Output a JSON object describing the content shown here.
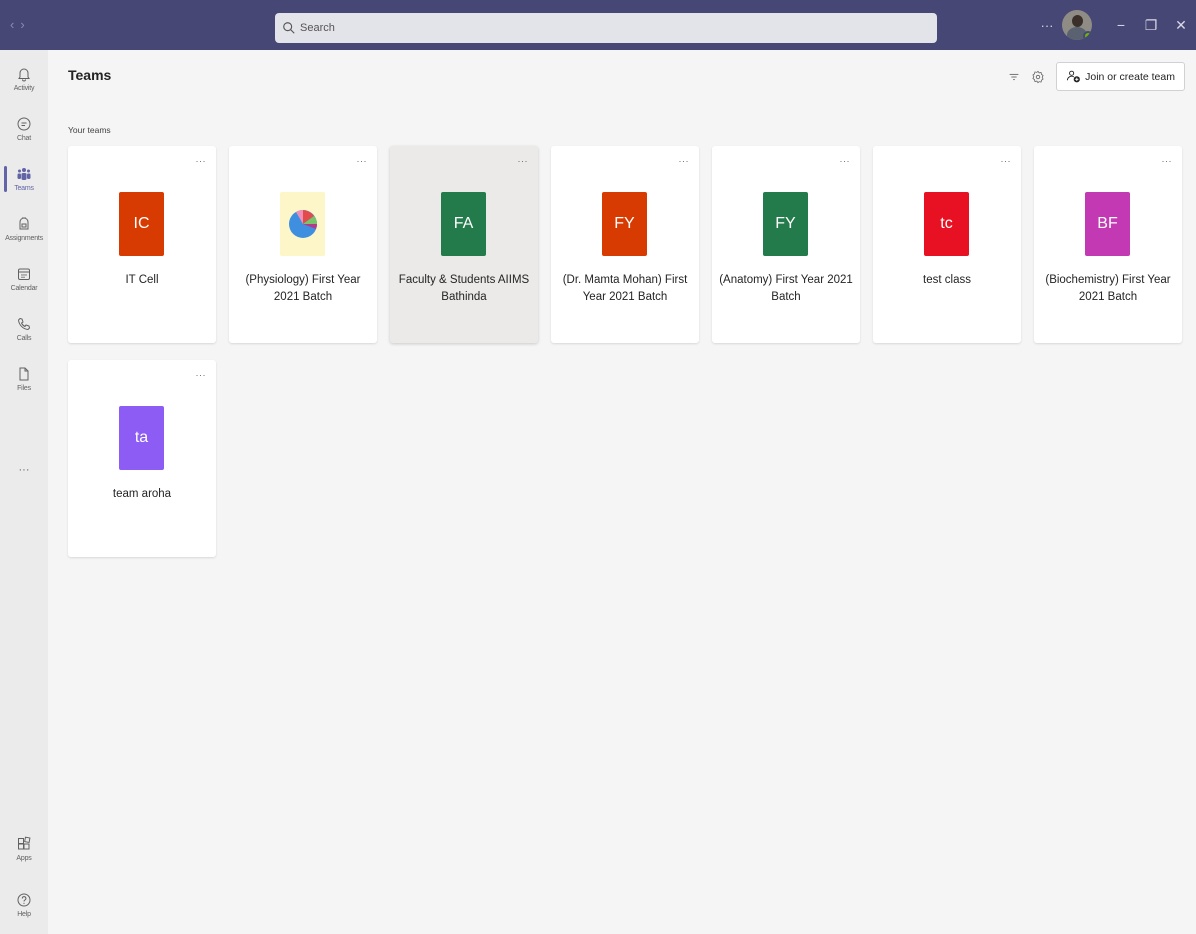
{
  "search": {
    "placeholder": "Search"
  },
  "titlebar": {
    "more": "···",
    "minimize": "−",
    "restore": "❐",
    "close": "✕"
  },
  "rail": [
    {
      "label": "Activity",
      "icon": "bell-icon"
    },
    {
      "label": "Chat",
      "icon": "chat-icon"
    },
    {
      "label": "Teams",
      "icon": "teams-icon",
      "active": true
    },
    {
      "label": "Assignments",
      "icon": "assignments-icon"
    },
    {
      "label": "Calendar",
      "icon": "calendar-icon"
    },
    {
      "label": "Calls",
      "icon": "phone-icon"
    },
    {
      "label": "Files",
      "icon": "file-icon"
    },
    {
      "label": "Apps",
      "icon": "apps-icon"
    },
    {
      "label": "Help",
      "icon": "help-icon"
    }
  ],
  "rail_more": "···",
  "header": {
    "title": "Teams",
    "join_label": "Join or create team"
  },
  "section_label": "Your teams",
  "teams": [
    {
      "initials": "IC",
      "name": "IT Cell",
      "color": "#d83b01"
    },
    {
      "initials": "",
      "name": "(Physiology) First Year 2021 Batch",
      "color": "#fdf6c9",
      "image": "pie-chart-logo"
    },
    {
      "initials": "FA",
      "name": "Faculty & Students AIIMS Bathinda",
      "color": "#237b4b",
      "selected": true
    },
    {
      "initials": "FY",
      "name": "(Dr. Mamta Mohan) First Year 2021 Batch",
      "color": "#d83b01"
    },
    {
      "initials": "FY",
      "name": "(Anatomy) First Year 2021 Batch",
      "color": "#237b4b"
    },
    {
      "initials": "tc",
      "name": "test class",
      "color": "#e81123"
    },
    {
      "initials": "BF",
      "name": "(Biochemistry) First Year 2021 Batch",
      "color": "#c239b3"
    },
    {
      "initials": "ta",
      "name": "team aroha",
      "color": "#8c5cf5"
    }
  ],
  "card_more": "···"
}
